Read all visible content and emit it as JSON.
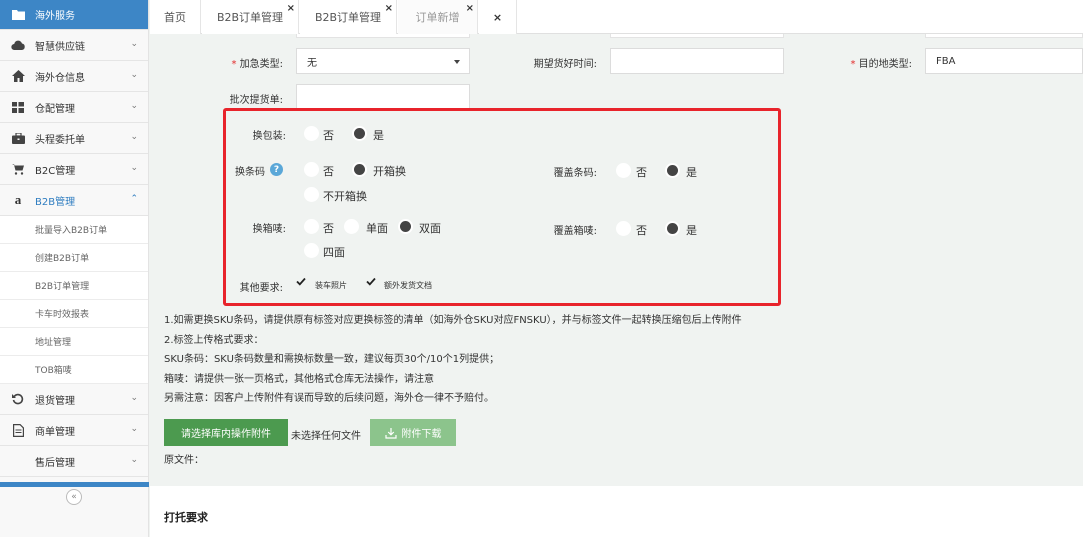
{
  "sidebar": {
    "items": [
      {
        "label": "海外服务",
        "icon": "folder-icon"
      },
      {
        "label": "智慧供应链",
        "icon": "cloud-icon"
      },
      {
        "label": "海外仓信息",
        "icon": "home-icon"
      },
      {
        "label": "仓配管理",
        "icon": "grid-icon"
      },
      {
        "label": "头程委托单",
        "icon": "briefcase-icon"
      },
      {
        "label": "B2C管理",
        "icon": "cart-icon"
      },
      {
        "label": "B2B管理",
        "icon": "amazon-icon"
      }
    ],
    "submenu": [
      "批量导入B2B订单",
      "创建B2B订单",
      "B2B订单管理",
      "卡车时效报表",
      "地址管理",
      "TOB箱唛"
    ],
    "bottom_items": [
      {
        "label": "退货管理",
        "icon": "undo-icon"
      },
      {
        "label": "商单管理",
        "icon": "document-icon"
      },
      {
        "label": "售后管理",
        "icon": ""
      }
    ],
    "collapse": "«"
  },
  "tabs": {
    "home": "首页",
    "t1": "B2B订单管理",
    "t2": "B2B订单管理",
    "t3": "订单新增",
    "close": "×"
  },
  "form": {
    "urgent_label": "加急类型:",
    "urgent_value": "无",
    "expected_time_label": "期望货好时间:",
    "destination_label": "目的地类型:",
    "destination_value": "FBA",
    "batch_label": "批次提货单:",
    "repack": {
      "label": "换包装:",
      "options": [
        "否",
        "是"
      ],
      "selected": "是"
    },
    "relabel": {
      "label": "换条码",
      "options": [
        "否",
        "开箱换",
        "不开箱换"
      ],
      "selected": "开箱换"
    },
    "cover_barcode": {
      "label": "覆盖条码:",
      "options": [
        "否",
        "是"
      ],
      "selected": "是"
    },
    "change_mark": {
      "label": "换箱唛:",
      "options": [
        "否",
        "单面",
        "双面",
        "四面"
      ],
      "selected": "双面"
    },
    "cover_mark": {
      "label": "覆盖箱唛:",
      "options": [
        "否",
        "是"
      ],
      "selected": "是"
    },
    "other": {
      "label": "其他要求:",
      "checks": [
        "装车照片",
        "额外发货文档"
      ]
    }
  },
  "notes": [
    "1.如需更换SKU条码，请提供原有标签对应更换标签的清单（如海外仓SKU对应FNSKU），并与标签文件一起转换压缩包后上传附件",
    "2.标签上传格式要求：",
    "SKU条码：SKU条码数量和需换标数量一致，建议每页30个/10个1列提供；",
    "箱唛：请提供一张一页格式，其他格式仓库无法操作，请注意",
    "另需注意：因客户上传附件有误而导致的后续问题，海外仓一律不予赔付。"
  ],
  "upload": {
    "choose_button": "请选择库内操作附件",
    "no_file": "未选择任何文件",
    "download_button": "附件下载",
    "original_file": "原文件："
  },
  "section2_title": "打托要求",
  "colors": {
    "accent": "#3d86c6",
    "green": "#4c9a4f",
    "highlight": "#e8232b",
    "required": "#e32b2b"
  }
}
